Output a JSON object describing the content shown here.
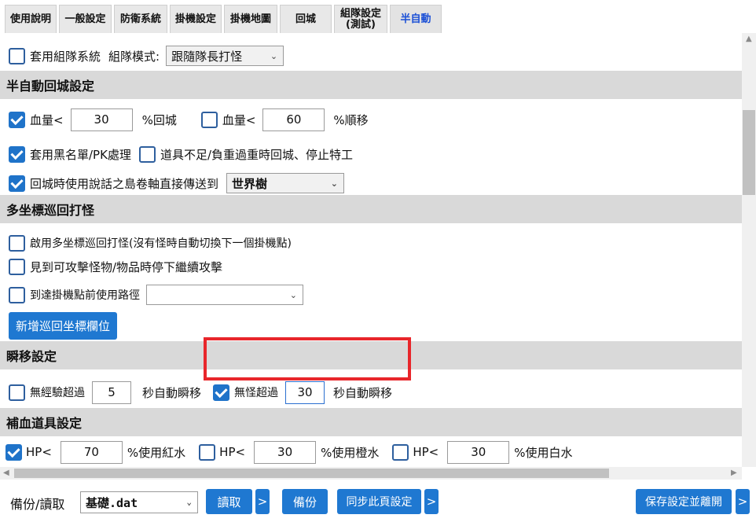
{
  "tabs": [
    {
      "label": "使用說明"
    },
    {
      "label": "一般設定"
    },
    {
      "label": "防衛系統"
    },
    {
      "label": "掛機設定"
    },
    {
      "label": "掛機地圖"
    },
    {
      "label": "回城"
    },
    {
      "label_line1": "組隊設定",
      "label_line2": "(測試)"
    },
    {
      "label": "半自動"
    }
  ],
  "party": {
    "checkbox_label": "套用組隊系統",
    "mode_label": "組隊模式:",
    "mode_value": "跟隨隊長打怪"
  },
  "semi_return": {
    "heading": "半自動回城設定",
    "hp_return": {
      "label": "血量<",
      "value": "30",
      "suffix": "%回城",
      "checked": true
    },
    "hp_teleport": {
      "label": "血量<",
      "value": "60",
      "suffix": "%順移",
      "checked": false
    },
    "blacklist": {
      "label": "套用黑名單/PK處理",
      "checked": true
    },
    "items_low": {
      "label": "道具不足/負重過重時回城、停止特工",
      "checked": false
    },
    "scroll": {
      "label": "回城時使用說話之島卷軸直接傳送到",
      "checked": true,
      "destination": "世界樹"
    }
  },
  "patrol": {
    "heading": "多坐標巡回打怪",
    "enable": {
      "label": "啟用多坐標巡回打怪(沒有怪時自動切換下一個掛機點)",
      "checked": false
    },
    "stop_on_item": {
      "label": "見到可攻擊怪物/物品時停下繼續攻擊",
      "checked": false
    },
    "path": {
      "label": "到達掛機點前使用路徑",
      "checked": false,
      "value": ""
    },
    "add_button": "新增巡回坐標欄位"
  },
  "teleport": {
    "heading": "瞬移設定",
    "no_exp": {
      "label": "無經驗超過",
      "value": "5",
      "suffix": "秒自動瞬移",
      "checked": false
    },
    "no_monster": {
      "label": "無怪超過",
      "value": "30",
      "suffix": "秒自動瞬移",
      "checked": true
    }
  },
  "potions": {
    "heading": "補血道具設定",
    "red": {
      "label": "HP<",
      "value": "70",
      "suffix": "%使用紅水",
      "checked": true
    },
    "orange": {
      "label": "HP<",
      "value": "30",
      "suffix": "%使用橙水",
      "checked": false
    },
    "white": {
      "label": "HP<",
      "value": "30",
      "suffix": "%使用白水",
      "checked": false
    }
  },
  "footer": {
    "backup_label": "備份/讀取",
    "file_value": "基礎.dat",
    "read_button": "讀取",
    "more_glyph": ">",
    "backup_button": "備份",
    "sync_button": "同步此頁設定",
    "save_exit_button": "保存設定並離開"
  },
  "colors": {
    "accent": "#1f78d1",
    "highlight": "#e8262b",
    "section_bg": "#d9d9d9",
    "active_tab_text": "#1a4fd6"
  }
}
